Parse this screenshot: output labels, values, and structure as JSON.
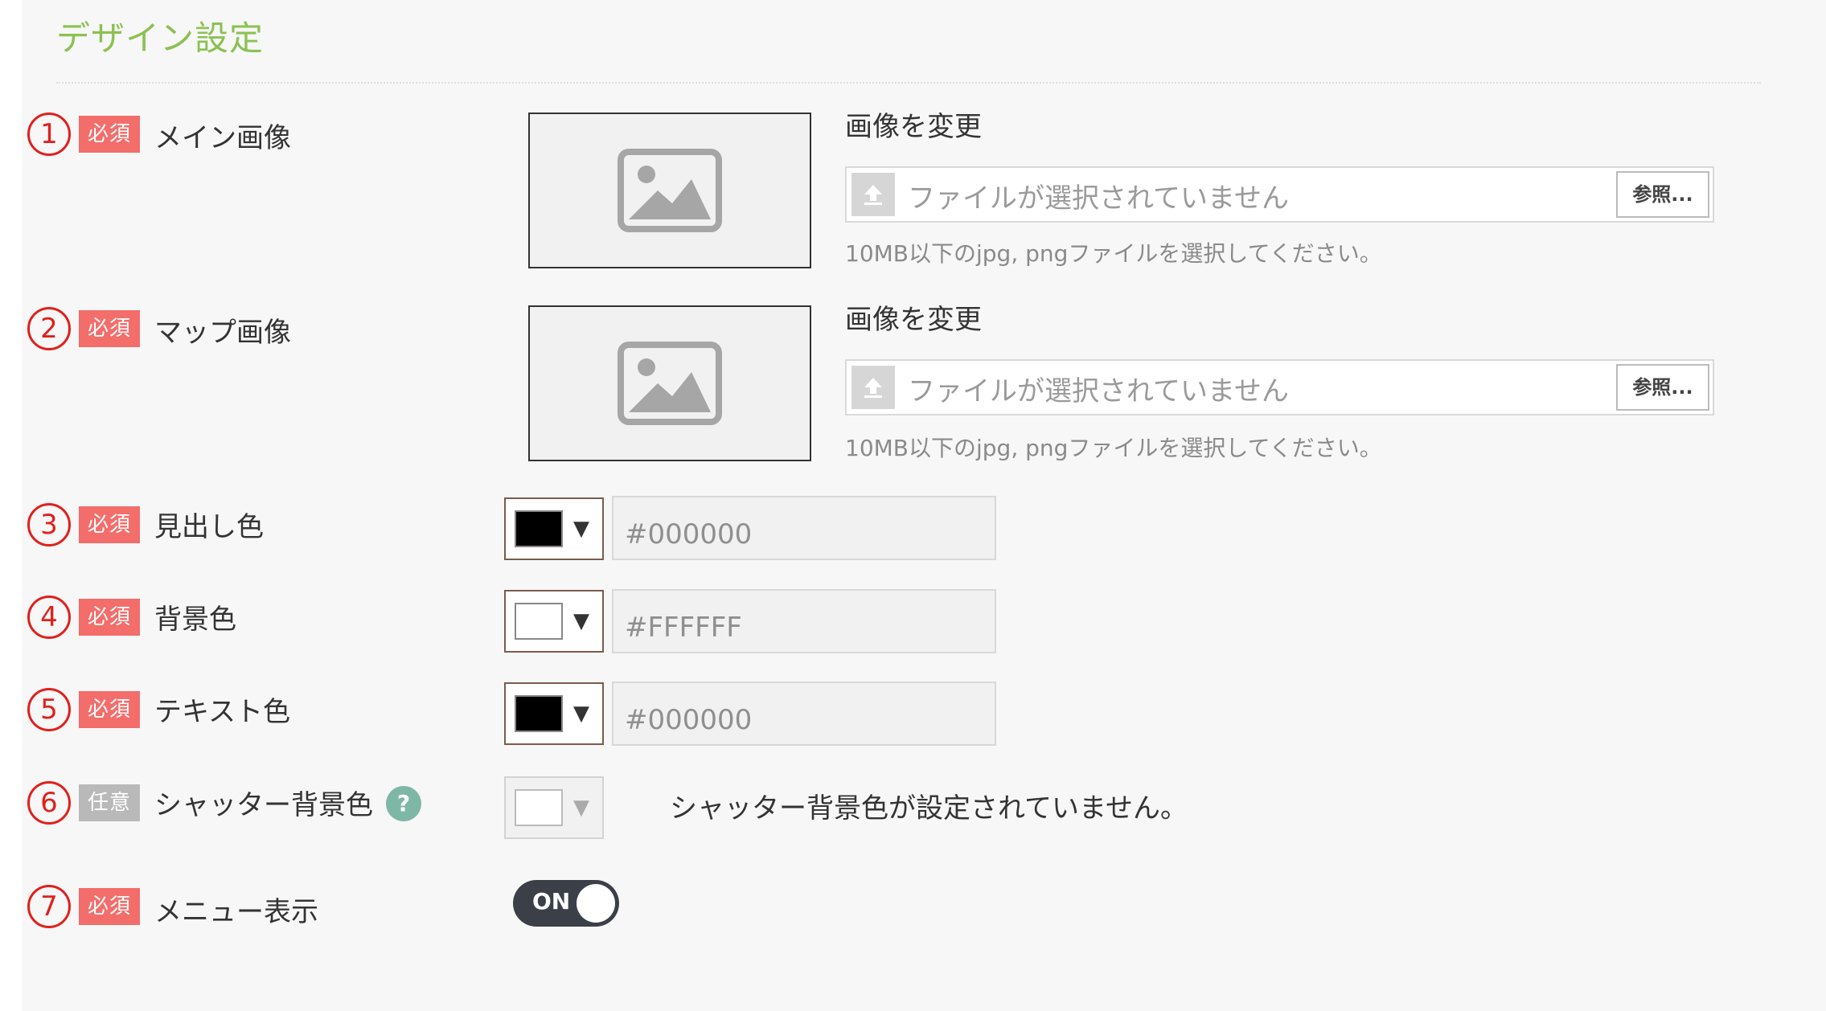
{
  "section": {
    "title": "デザイン設定"
  },
  "badges": {
    "required": "必須",
    "optional": "任意"
  },
  "file_upload": {
    "change_label": "画像を変更",
    "no_file": "ファイルが選択されていません",
    "browse": "参照...",
    "hint": "10MB以下のjpg, pngファイルを選択してください。"
  },
  "fields": {
    "main_image": {
      "num": "1",
      "label": "メイン画像"
    },
    "map_image": {
      "num": "2",
      "label": "マップ画像"
    },
    "heading_color": {
      "num": "3",
      "label": "見出し色",
      "value": "#000000"
    },
    "background_color": {
      "num": "4",
      "label": "背景色",
      "value": "#FFFFFF"
    },
    "text_color": {
      "num": "5",
      "label": "テキスト色",
      "value": "#000000"
    },
    "shutter_color": {
      "num": "6",
      "label": "シャッター背景色",
      "help": "?",
      "note": "シャッター背景色が設定されていません。"
    },
    "menu_display": {
      "num": "7",
      "label": "メニュー表示",
      "toggle": "ON"
    }
  },
  "colors": {
    "accent_green": "#8cc152",
    "required_badge": "#f36d6b",
    "optional_badge": "#b9b9b9",
    "marker_red": "#e0201c"
  }
}
